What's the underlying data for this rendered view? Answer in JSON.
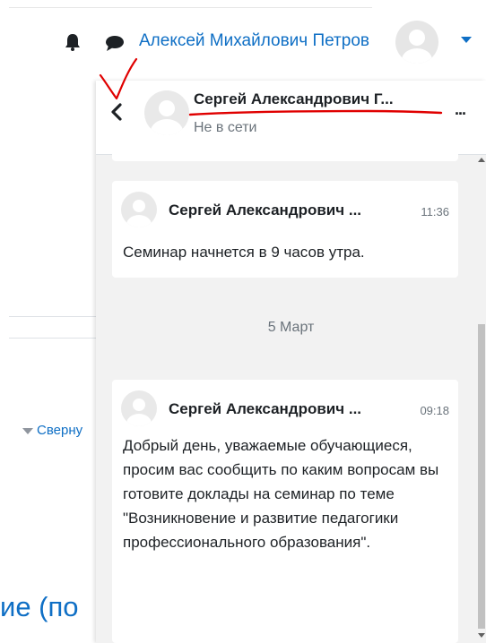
{
  "navbar": {
    "user_name": "Алексей Михайлович Петров",
    "icons": {
      "notifications": "bell-icon",
      "messages": "chat-icon",
      "menu": "chevron-down-icon"
    }
  },
  "background": {
    "collapse_link": "Сверну",
    "heading_fragment": "ие (по"
  },
  "drawer": {
    "header": {
      "contact_name": "Сергей Александрович Г...",
      "status": "Не в сети",
      "more_label": "..."
    },
    "messages": [
      {
        "author": "Сергей Александрович ...",
        "time": "11:36",
        "text": "Семинар начнется в 9 часов утра."
      },
      {
        "author": "Сергей Александрович ...",
        "time": "09:18",
        "text": "Добрый день, уважаемые обучающиеся, просим вас сообщить по каким вопросам вы готовите доклады на семинар по теме \"Возникновение и развитие педагогики профессионального образования\"."
      }
    ],
    "date_separator": "5 Март"
  },
  "colors": {
    "link": "#0f6fc5",
    "drawer_bg": "#f2f2f2",
    "annotation": "#e00000"
  }
}
